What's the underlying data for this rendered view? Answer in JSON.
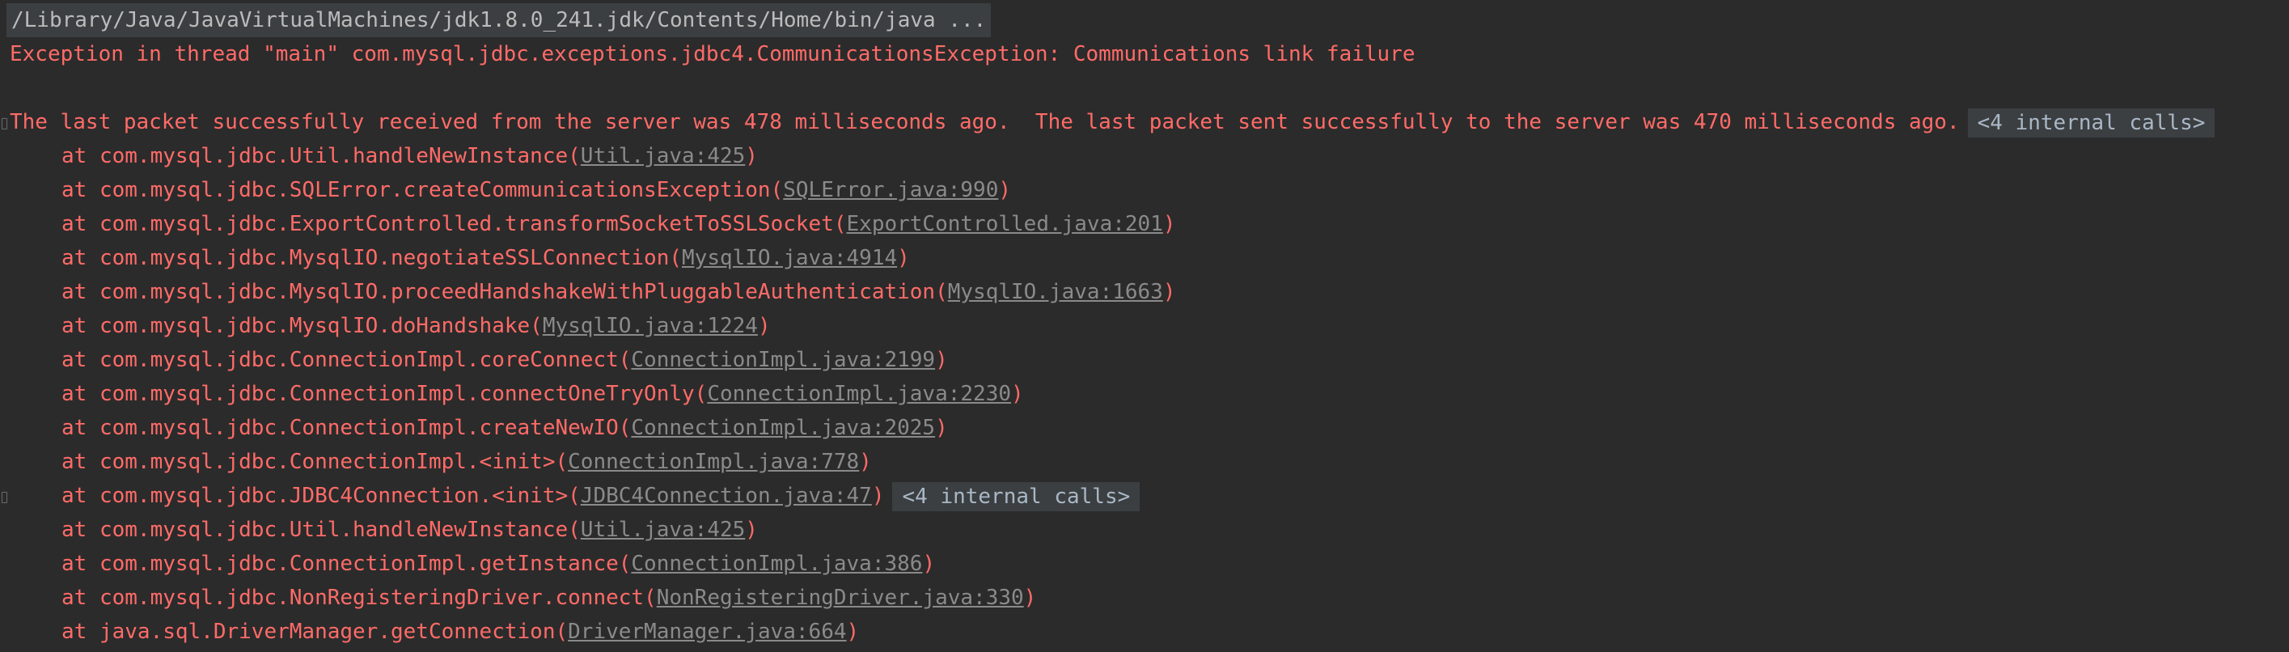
{
  "command": "/Library/Java/JavaVirtualMachines/jdk1.8.0_241.jdk/Contents/Home/bin/java ...",
  "exception": "Exception in thread \"main\" com.mysql.jdbc.exceptions.jdbc4.CommunicationsException: Communications link failure",
  "message": "The last packet successfully received from the server was 478 milliseconds ago.  The last packet sent successfully to the server was 470 milliseconds ago.",
  "internal_calls_badge": "<4 internal calls>",
  "frames": [
    {
      "prefix": "at com.mysql.jdbc.Util.handleNewInstance(",
      "link": "Util.java:425",
      "suffix": ")"
    },
    {
      "prefix": "at com.mysql.jdbc.SQLError.createCommunicationsException(",
      "link": "SQLError.java:990",
      "suffix": ")"
    },
    {
      "prefix": "at com.mysql.jdbc.ExportControlled.transformSocketToSSLSocket(",
      "link": "ExportControlled.java:201",
      "suffix": ")"
    },
    {
      "prefix": "at com.mysql.jdbc.MysqlIO.negotiateSSLConnection(",
      "link": "MysqlIO.java:4914",
      "suffix": ")"
    },
    {
      "prefix": "at com.mysql.jdbc.MysqlIO.proceedHandshakeWithPluggableAuthentication(",
      "link": "MysqlIO.java:1663",
      "suffix": ")"
    },
    {
      "prefix": "at com.mysql.jdbc.MysqlIO.doHandshake(",
      "link": "MysqlIO.java:1224",
      "suffix": ")"
    },
    {
      "prefix": "at com.mysql.jdbc.ConnectionImpl.coreConnect(",
      "link": "ConnectionImpl.java:2199",
      "suffix": ")"
    },
    {
      "prefix": "at com.mysql.jdbc.ConnectionImpl.connectOneTryOnly(",
      "link": "ConnectionImpl.java:2230",
      "suffix": ")"
    },
    {
      "prefix": "at com.mysql.jdbc.ConnectionImpl.createNewIO(",
      "link": "ConnectionImpl.java:2025",
      "suffix": ")"
    },
    {
      "prefix": "at com.mysql.jdbc.ConnectionImpl.<init>(",
      "link": "ConnectionImpl.java:778",
      "suffix": ")"
    },
    {
      "prefix": "at com.mysql.jdbc.JDBC4Connection.<init>(",
      "link": "JDBC4Connection.java:47",
      "suffix": ")",
      "badge": "<4 internal calls>"
    },
    {
      "prefix": "at com.mysql.jdbc.Util.handleNewInstance(",
      "link": "Util.java:425",
      "suffix": ")"
    },
    {
      "prefix": "at com.mysql.jdbc.ConnectionImpl.getInstance(",
      "link": "ConnectionImpl.java:386",
      "suffix": ")"
    },
    {
      "prefix": "at com.mysql.jdbc.NonRegisteringDriver.connect(",
      "link": "NonRegisteringDriver.java:330",
      "suffix": ")"
    },
    {
      "prefix": "at java.sql.DriverManager.getConnection(",
      "link": "DriverManager.java:664",
      "suffix": ")"
    }
  ],
  "colors": {
    "background": "#2b2b2b",
    "error_text": "#ff6b68",
    "link_text": "#8a8a8a",
    "badge_background": "#3c3f41"
  }
}
